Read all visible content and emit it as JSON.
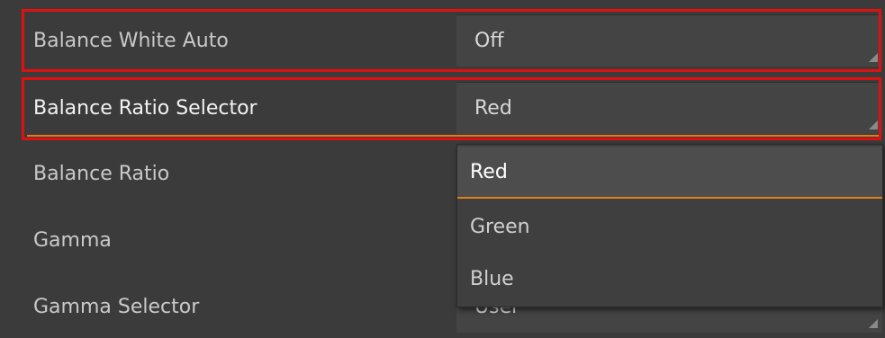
{
  "properties": [
    {
      "label": "Balance White Auto",
      "value": "Off"
    },
    {
      "label": "Balance Ratio Selector",
      "value": "Red"
    },
    {
      "label": "Balance Ratio",
      "value": ""
    },
    {
      "label": "Gamma",
      "value": ""
    },
    {
      "label": "Gamma Selector",
      "value": "User"
    }
  ],
  "dropdown": {
    "options": [
      "Red",
      "Green",
      "Blue"
    ],
    "selected": "Red"
  },
  "colors": {
    "background": "#3b3b3b",
    "highlight_border": "#e01010",
    "selection_accent": "#e0801a"
  }
}
